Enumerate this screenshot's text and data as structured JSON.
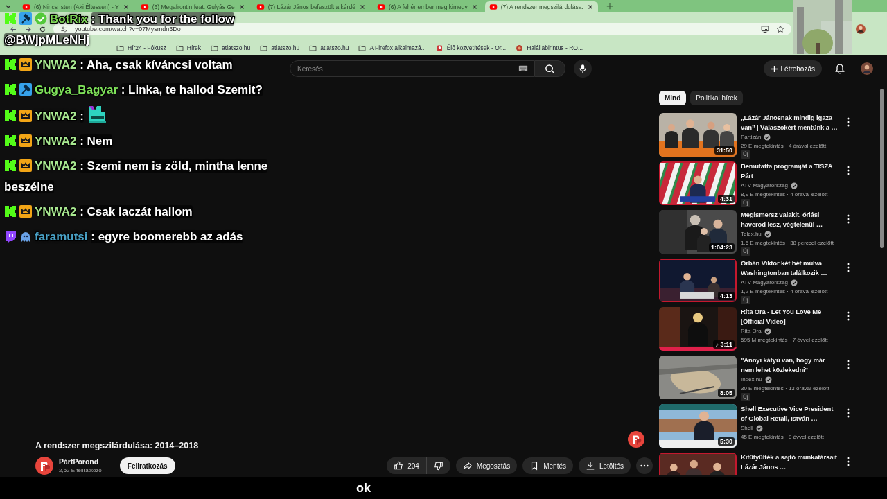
{
  "browser": {
    "tabs": [
      {
        "title": "(6) Nincs Isten (Aki Éltessen) - Y",
        "selected": false
      },
      {
        "title": "(6) Megafrontin feat. Gulyás Ge",
        "selected": false
      },
      {
        "title": "(7) Lázár János befeszült a kérdé",
        "selected": false
      },
      {
        "title": "(6) A fehér ember meg kimegy",
        "selected": false
      },
      {
        "title": "(7) A rendszer megszilárdulása:",
        "selected": true
      }
    ],
    "url": "youtube.com/watch?v=07Mysmdn3Do",
    "bookmarks": [
      {
        "kind": "folder",
        "label": "Hír24 - Fókusz"
      },
      {
        "kind": "folder",
        "label": "Hírek"
      },
      {
        "kind": "folder",
        "label": "atlatszo.hu"
      },
      {
        "kind": "folder",
        "label": "atlatszo.hu"
      },
      {
        "kind": "folder",
        "label": "atlatszo.hu"
      },
      {
        "kind": "folder",
        "label": "A Firefox alkalmazá..."
      },
      {
        "kind": "site",
        "label": "Élő közvetítések - Or..."
      },
      {
        "kind": "game",
        "label": "Halállabirintus - RO..."
      }
    ]
  },
  "youtube": {
    "search": {
      "placeholder": "Keresés"
    },
    "create_button": "Létrehozás",
    "chips": [
      {
        "label": "Mind",
        "selected": true
      },
      {
        "label": "Politikai hírek",
        "selected": false
      }
    ],
    "recommendations": [
      {
        "title": "„Lázár Jánosnak mindig igaza van” | Válaszokért mentünk a …",
        "channel": "Partizán",
        "meta": "29 E megtekintés · 4 órával ezelőtt",
        "badge": "Új",
        "duration": "31:50",
        "highlighted": false
      },
      {
        "title": "Bemutatta programját a TISZA Párt",
        "channel": "ATV Magyarország",
        "meta": "8,9 E megtekintés · 4 órával ezelőtt",
        "badge": "Új",
        "duration": "4:31",
        "highlighted": true
      },
      {
        "title": "Megismersz valakit, óriási haverod lesz, végtelenül …",
        "channel": "Telex.hu",
        "meta": "1,6 E megtekintés · 38 perccel ezelőtt",
        "badge": "Új",
        "duration": "1:04:23",
        "highlighted": false
      },
      {
        "title": "Orbán Viktor két hét múlva Washingtonban találkozik …",
        "channel": "ATV Magyarország",
        "meta": "1,2 E megtekintés · 4 órával ezelőtt",
        "badge": "Új",
        "duration": "4:13",
        "highlighted": true
      },
      {
        "title": "Rita Ora - Let You Love Me [Official Video]",
        "channel": "Rita Ora",
        "meta": "595 M megtekintés · 7 évvel ezelőtt",
        "duration": "♪ 3:11",
        "highlighted": false
      },
      {
        "title": "\"Annyi kátyú van, hogy már nem lehet közlekedni\"",
        "channel": "Index.hu",
        "meta": "30 E megtekintés · 13 órával ezelőtt",
        "badge": "Új",
        "duration": "8:05",
        "highlighted": false
      },
      {
        "title": "Shell Executive Vice President of Global Retail, István …",
        "channel": "Shell",
        "meta": "45 E megtekintés · 9 évvel ezelőtt",
        "duration": "5:30",
        "highlighted": false
      },
      {
        "title": "Kifütyülték a sajtó munkatársait Lázár János …",
        "highlighted": true
      }
    ],
    "video": {
      "title": "A rendszer megszilárdulása: 2014–2018",
      "channel": "PártPorond",
      "subscribers": "2,52 E feliratkozó",
      "subscribe_button": "Feliratkozás",
      "likes": "204",
      "actions": [
        {
          "kind": "share",
          "label": "Megosztás"
        },
        {
          "kind": "save",
          "label": "Mentés"
        },
        {
          "kind": "download",
          "label": "Letöltés"
        }
      ]
    }
  },
  "chat": {
    "messages": [
      {
        "badges": [
          {
            "kind": "kick"
          },
          {
            "kind": "moderator"
          },
          {
            "kind": "verified"
          }
        ],
        "user": "BotRix",
        "color": "#7ed957",
        "text": ": Thank you for the follow",
        "continuation": "@BWjpMLeNHj"
      },
      {
        "badges": [
          {
            "kind": "kick"
          },
          {
            "kind": "crown"
          }
        ],
        "user": "YNWA2",
        "color": "#a8e890",
        "text": ": Aha, csak kíváncsi voltam"
      },
      {
        "badges": [
          {
            "kind": "kick"
          },
          {
            "kind": "moderator"
          }
        ],
        "user": "Gugya_Bagyar",
        "color": "#7fe35a",
        "text": ": Linka, te hallod Szemit?"
      },
      {
        "badges": [
          {
            "kind": "kick"
          },
          {
            "kind": "crown"
          }
        ],
        "user": "YNWA2",
        "color": "#a8e890",
        "text": ":",
        "emote": true
      },
      {
        "badges": [
          {
            "kind": "kick"
          },
          {
            "kind": "crown"
          }
        ],
        "user": "YNWA2",
        "color": "#a8e890",
        "text": ": Nem"
      },
      {
        "badges": [
          {
            "kind": "kick"
          },
          {
            "kind": "crown"
          }
        ],
        "user": "YNWA2",
        "color": "#a8e890",
        "text": ": Szemi nem is zöld, mintha lenne",
        "continuation": "beszélne"
      },
      {
        "badges": [
          {
            "kind": "kick"
          },
          {
            "kind": "crown"
          }
        ],
        "user": "YNWA2",
        "color": "#a8e890",
        "text": ": Csak laczát hallom"
      },
      {
        "badges": [
          {
            "kind": "twitch"
          },
          {
            "kind": "ghost"
          }
        ],
        "user": "faramutsi",
        "color": "#4aa3c8",
        "text": ": egyre boomerebb az adás"
      }
    ]
  },
  "caption": "ok"
}
